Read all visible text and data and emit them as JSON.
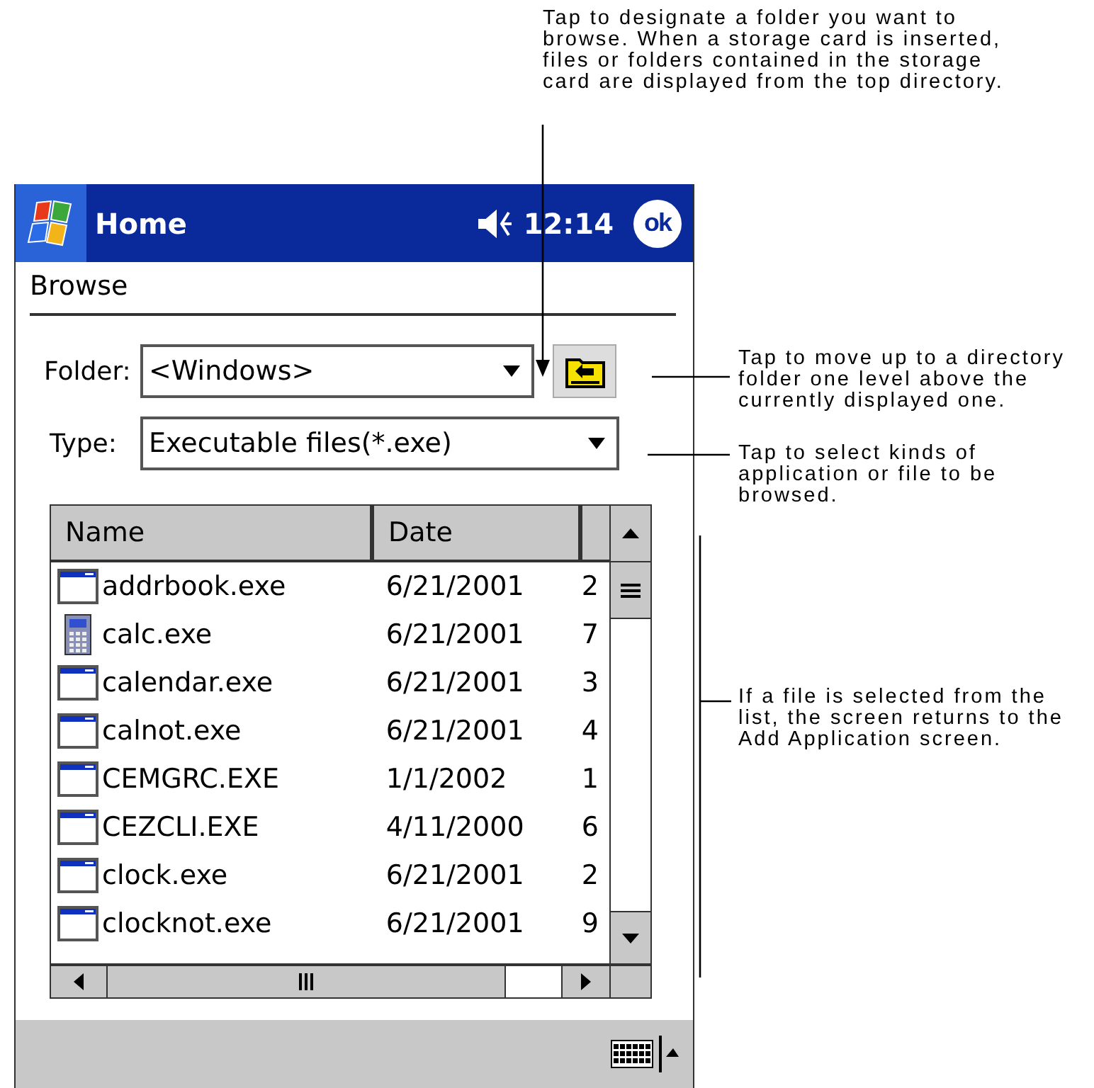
{
  "title_bar": {
    "title": "Home",
    "time": "12:14",
    "ok": "ok"
  },
  "header": {
    "title": "Browse"
  },
  "folder": {
    "label": "Folder:",
    "value": "<Windows>"
  },
  "type": {
    "label": "Type:",
    "value": "Executable files(*.exe)"
  },
  "file_list": {
    "columns": [
      "Name",
      "Date"
    ],
    "rows": [
      {
        "name": "addrbook.exe",
        "date": "6/21/2001",
        "column_3": "2",
        "kind": "app"
      },
      {
        "name": "calc.exe",
        "date": "6/21/2001",
        "column_3": "7",
        "kind": "calculator"
      },
      {
        "name": "calendar.exe",
        "date": "6/21/2001",
        "column_3": "3",
        "kind": "app"
      },
      {
        "name": "calnot.exe",
        "date": "6/21/2001",
        "column_3": "4",
        "kind": "app"
      },
      {
        "name": "CEMGRC.EXE",
        "date": "1/1/2002",
        "column_3": "1",
        "kind": "app"
      },
      {
        "name": "CEZCLI.EXE",
        "date": "4/11/2000",
        "column_3": "6",
        "kind": "app"
      },
      {
        "name": "clock.exe",
        "date": "6/21/2001",
        "column_3": "2",
        "kind": "app"
      },
      {
        "name": "clocknot.exe",
        "date": "6/21/2001",
        "column_3": "9",
        "kind": "app"
      }
    ]
  },
  "annotations": [
    {
      "lines": [
        "Tap to designate a folder you want to",
        "browse. When  a storage card is inserted,",
        "files or folders contained in the storage",
        "card are displayed from the top directory."
      ]
    },
    {
      "lines": [
        "Tap to move up to a directory",
        "folder one level above the",
        "currently displayed one."
      ]
    },
    {
      "lines": [
        "Tap to select kinds of",
        "application or file to be",
        "browsed."
      ]
    },
    {
      "lines": [
        "If a file is selected from the",
        "list, the screen returns to the",
        "Add Application screen."
      ]
    }
  ]
}
